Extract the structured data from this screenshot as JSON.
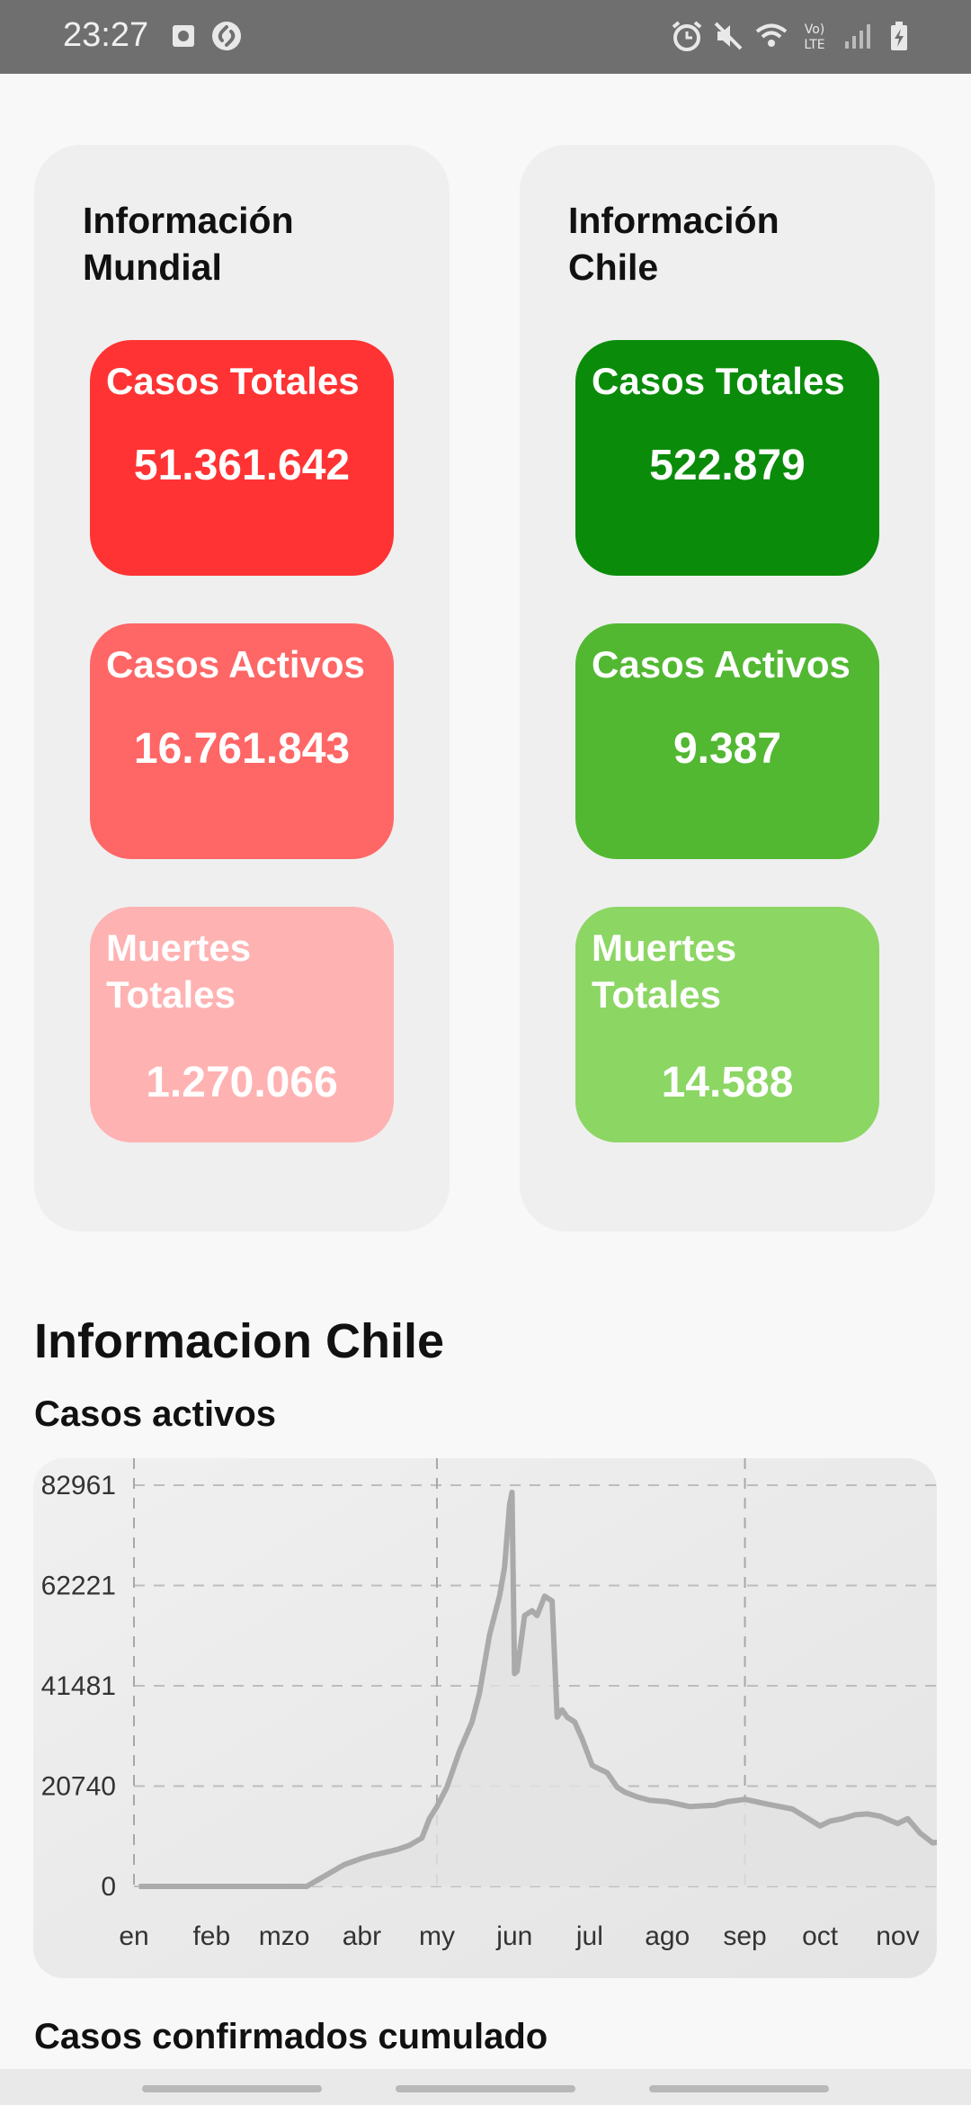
{
  "status_bar": {
    "time": "23:27",
    "icons": [
      "photo-notification-icon",
      "shazam-icon",
      "alarm-icon",
      "mute-icon",
      "wifi-icon",
      "volte-icon",
      "signal-icon",
      "battery-charging-icon"
    ]
  },
  "cards": [
    {
      "title": "Información\nMundial",
      "stats": [
        {
          "label": "Casos Totales",
          "value": "51.361.642",
          "color": "#ff3333"
        },
        {
          "label": "Casos Activos",
          "value": "16.761.843",
          "color": "#ff6666"
        },
        {
          "label": "Muertes Totales",
          "value": "1.270.066",
          "color": "#ffb2b2"
        }
      ]
    },
    {
      "title": "Información\n Chile",
      "stats": [
        {
          "label": "Casos Totales",
          "value": "522.879",
          "color": "#0a8c0a"
        },
        {
          "label": "Casos Activos",
          "value": "9.387",
          "color": "#52b832"
        },
        {
          "label": "Muertes Totales",
          "value": "14.588",
          "color": "#8cd664"
        }
      ]
    }
  ],
  "section_title": "Informacion Chile",
  "chart_subtitle": "Casos activos",
  "bottom_subtitle": "Casos confirmados cumulado",
  "chart_data": {
    "type": "area",
    "x_tick_labels": [
      "en",
      "feb",
      "mzo",
      "abr",
      "my",
      "jun",
      "jul",
      "ago",
      "sep",
      "oct",
      "nov"
    ],
    "y_tick_labels": [
      "82961",
      "62221",
      "41481",
      "20740",
      "0"
    ],
    "ylim": [
      0,
      82961
    ],
    "grid": true,
    "line_color": "#aaaaaa",
    "fill_color": "#e2e2e2",
    "x": [
      "01-03",
      "01-20",
      "02-10",
      "02-25",
      "03-05",
      "03-10",
      "03-15",
      "03-20",
      "03-25",
      "04-01",
      "04-05",
      "04-10",
      "04-15",
      "04-20",
      "04-25",
      "04-28",
      "05-01",
      "05-05",
      "05-10",
      "05-15",
      "05-18",
      "05-22",
      "05-26",
      "05-28",
      "05-30",
      "05-31",
      "06-01",
      "06-02",
      "06-05",
      "06-08",
      "06-10",
      "06-13",
      "06-16",
      "06-18",
      "06-20",
      "06-22",
      "06-25",
      "06-28",
      "07-02",
      "07-08",
      "07-12",
      "07-15",
      "07-20",
      "07-25",
      "08-01",
      "08-10",
      "08-20",
      "08-25",
      "09-01",
      "09-10",
      "09-20",
      "10-01",
      "10-05",
      "10-10",
      "10-15",
      "10-20",
      "10-25",
      "11-01",
      "11-05",
      "11-10",
      "11-15",
      "11-18",
      "11-20",
      "11-25",
      "11-29"
    ],
    "y": [
      0,
      0,
      0,
      0,
      0,
      0,
      1500,
      3000,
      4500,
      5800,
      6400,
      7000,
      7600,
      8500,
      10000,
      14000,
      16500,
      20500,
      28000,
      34000,
      40000,
      52000,
      60000,
      66000,
      79000,
      81500,
      44000,
      44500,
      56000,
      57000,
      56000,
      60000,
      59000,
      35000,
      36500,
      35000,
      34000,
      30500,
      25000,
      23500,
      20500,
      19500,
      18500,
      17800,
      17500,
      16500,
      16800,
      17500,
      18000,
      17000,
      16000,
      12500,
      13500,
      14000,
      14800,
      15000,
      14500,
      13000,
      14000,
      11000,
      9000,
      9200,
      9000,
      9800,
      9500
    ]
  }
}
